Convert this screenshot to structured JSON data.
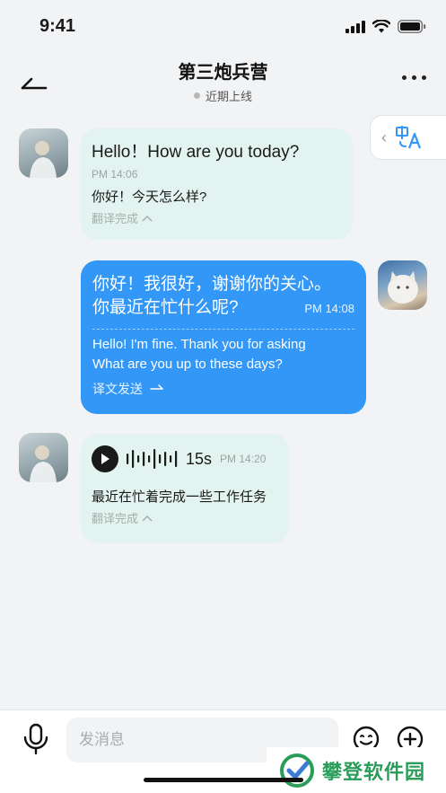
{
  "status_bar": {
    "time": "9:41"
  },
  "header": {
    "title": "第三炮兵营",
    "status": "近期上线"
  },
  "messages": [
    {
      "text": "Hello！How are you today?",
      "time": "PM 14:06",
      "translation": "你好！今天怎么样?",
      "status": "翻译完成"
    },
    {
      "text_line1": "你好！我很好，谢谢你的关心。",
      "text_line2": "你最近在忙什么呢?",
      "time": "PM 14:08",
      "translation_line1": "Hello! I'm fine. Thank you for asking",
      "translation_line2": "What are you up to these days?",
      "status": "译文发送"
    },
    {
      "duration": "15s",
      "time": "PM 14:20",
      "transcript": "最近在忙着完成一些工作任务",
      "status": "翻译完成"
    }
  ],
  "input": {
    "placeholder": "发消息"
  },
  "watermark": {
    "text": "攀登软件园"
  },
  "colors": {
    "accent": "#3297f6",
    "incoming_bubble": "#e3f4f0",
    "background": "#f2f3f5"
  }
}
